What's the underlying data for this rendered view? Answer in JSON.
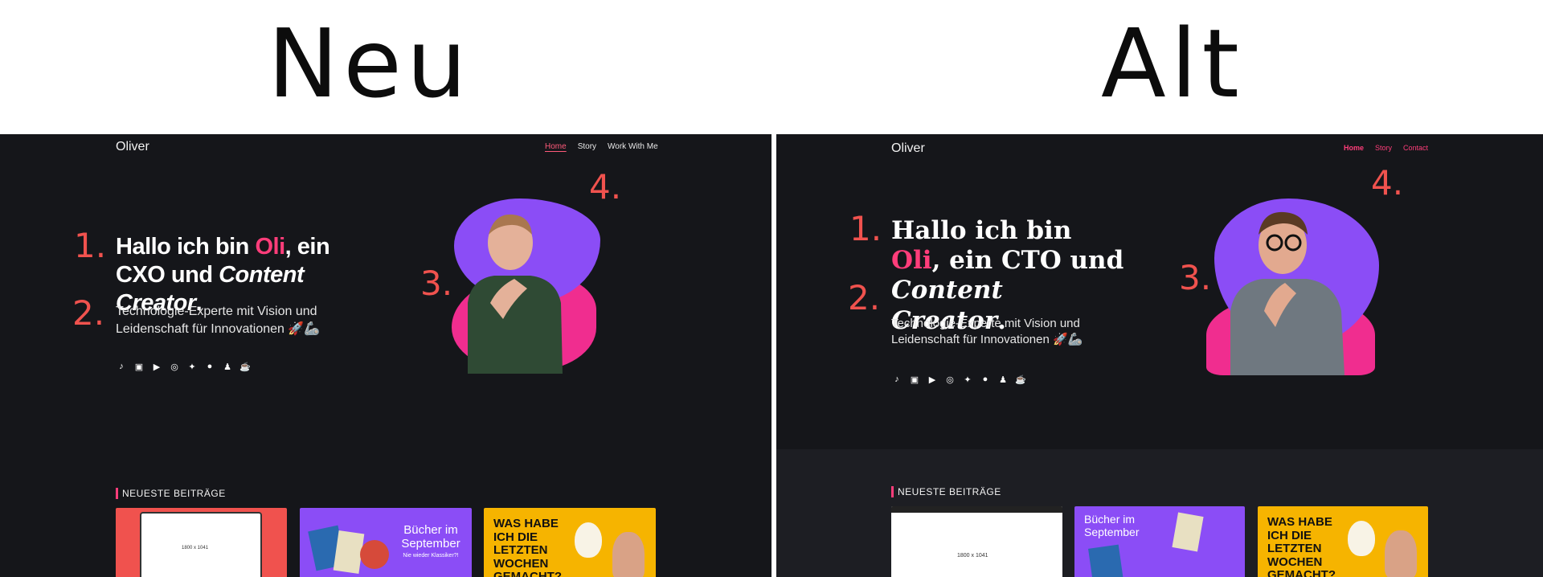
{
  "comparison": {
    "new_label": "Neu",
    "old_label": "Alt"
  },
  "new_site": {
    "logo": "Oliver",
    "nav": [
      "Home",
      "Story",
      "Work With Me"
    ],
    "headline": {
      "pre": "Hallo ich bin ",
      "accent": "Oli",
      "mid": ", ein CXO und ",
      "em": "Content Creator",
      "post": "."
    },
    "subtitle": "Technologie-Experte mit Vision und Leidenschaft für Innovationen 🚀🦾",
    "markers": [
      "1.",
      "2.",
      "3.",
      "4."
    ],
    "section_title": "NEUESTE BEITRÄGE",
    "cards": [
      {
        "placeholder": "1800 x 1041",
        "color": "#f0524e"
      },
      {
        "title": "Bücher im September",
        "subtitle": "Nie wieder Klassiker?!",
        "color": "#8b4df6"
      },
      {
        "title": "WAS HABE ICH DIE LETZTEN WOCHEN GEMACHT?",
        "color": "#f6b400"
      }
    ]
  },
  "old_site": {
    "logo": "Oliver",
    "nav": [
      "Home",
      "Story",
      "Contact"
    ],
    "headline": {
      "pre": "Hallo ich bin ",
      "accent": "Oli",
      "mid": ", ein CTO und ",
      "em": "Content Creator",
      "post": "."
    },
    "subtitle": "Technologie-Experte mit Vision und Leidenschaft für Innovationen 🚀🦾",
    "markers": [
      "1.",
      "2.",
      "3.",
      "4."
    ],
    "section_title": "NEUESTE BEITRÄGE",
    "cards": [
      {
        "placeholder": "1800 x 1041",
        "color": "#ffffff"
      },
      {
        "title": "Bücher im September",
        "color": "#8b4df6"
      },
      {
        "title": "WAS HABE ICH DIE LETZTEN WOCHEN GEMACHT?",
        "color": "#f6b400"
      }
    ]
  },
  "social_icons": [
    "tiktok-icon",
    "linkedin-icon",
    "youtube-icon",
    "instagram-icon",
    "twitter-icon",
    "github-icon",
    "snapchat-icon",
    "coffee-icon"
  ],
  "colors": {
    "accent": "#ff3d7a",
    "marker": "#f0524e",
    "purple": "#8b4df6",
    "pink": "#f02d8f",
    "bg": "#15161a"
  }
}
